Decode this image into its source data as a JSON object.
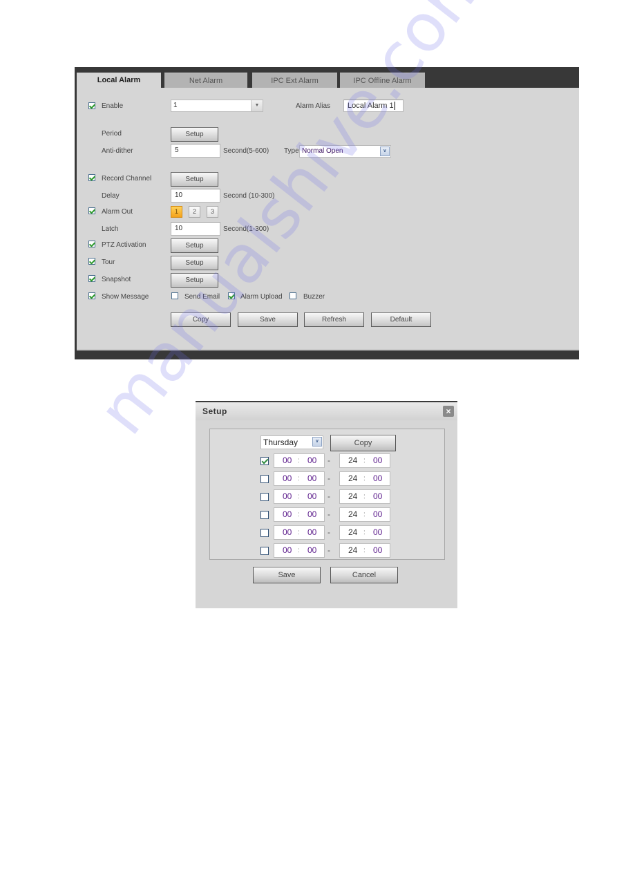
{
  "tabs": [
    {
      "label": "Local Alarm",
      "active": true
    },
    {
      "label": "Net Alarm",
      "active": false
    },
    {
      "label": "IPC Ext Alarm",
      "active": false
    },
    {
      "label": "IPC Offline Alarm",
      "active": false
    }
  ],
  "form": {
    "enable": {
      "label": "Enable",
      "checked": true
    },
    "channel_select": {
      "value": "1",
      "arrow_icon": "triangle-down"
    },
    "alarm_alias": {
      "label": "Alarm Alias",
      "value": "Local Alarm 1"
    },
    "period": {
      "label": "Period",
      "button": "Setup"
    },
    "anti_dither": {
      "label": "Anti-dither",
      "value": "5",
      "unit": "Second(5-600)"
    },
    "type": {
      "label": "Type",
      "value": "Normal Open"
    },
    "record_channel": {
      "label": "Record Channel",
      "checked": true,
      "button": "Setup"
    },
    "delay": {
      "label": "Delay",
      "value": "10",
      "unit": "Second (10-300)"
    },
    "alarm_out": {
      "label": "Alarm Out",
      "checked": true,
      "outputs": [
        {
          "label": "1",
          "active": true
        },
        {
          "label": "2",
          "active": false
        },
        {
          "label": "3",
          "active": false
        }
      ]
    },
    "latch": {
      "label": "Latch",
      "value": "10",
      "unit": "Second(1-300)"
    },
    "ptz_activation": {
      "label": "PTZ Activation",
      "checked": true,
      "button": "Setup"
    },
    "tour": {
      "label": "Tour",
      "checked": true,
      "button": "Setup"
    },
    "snapshot": {
      "label": "Snapshot",
      "checked": true,
      "button": "Setup"
    },
    "show_message": {
      "label": "Show Message",
      "checked": true
    },
    "send_email": {
      "label": "Send Email",
      "checked": false
    },
    "alarm_upload": {
      "label": "Alarm Upload",
      "checked": true
    },
    "buzzer": {
      "label": "Buzzer",
      "checked": false
    }
  },
  "actions": {
    "copy": "Copy",
    "save": "Save",
    "refresh": "Refresh",
    "default": "Default"
  },
  "dialog": {
    "title": "Setup",
    "close_icon": "×",
    "day": "Thursday",
    "copy": "Copy",
    "periods": [
      {
        "enabled": true,
        "start_h": "00",
        "start_m": "00",
        "end_h": "24",
        "end_m": "00"
      },
      {
        "enabled": false,
        "start_h": "00",
        "start_m": "00",
        "end_h": "24",
        "end_m": "00"
      },
      {
        "enabled": false,
        "start_h": "00",
        "start_m": "00",
        "end_h": "24",
        "end_m": "00"
      },
      {
        "enabled": false,
        "start_h": "00",
        "start_m": "00",
        "end_h": "24",
        "end_m": "00"
      },
      {
        "enabled": false,
        "start_h": "00",
        "start_m": "00",
        "end_h": "24",
        "end_m": "00"
      },
      {
        "enabled": false,
        "start_h": "00",
        "start_m": "00",
        "end_h": "24",
        "end_m": "00"
      }
    ],
    "time_sep": ":",
    "range_sep": "-",
    "save": "Save",
    "cancel": "Cancel"
  },
  "colors": {
    "frame_dark": "#383838",
    "panel_bg": "#d6d6d6",
    "active_output": "#f4a21b",
    "check_green": "#2e9a2e",
    "time_purple": "#5a1a8a"
  },
  "watermark": "manualshive.com"
}
